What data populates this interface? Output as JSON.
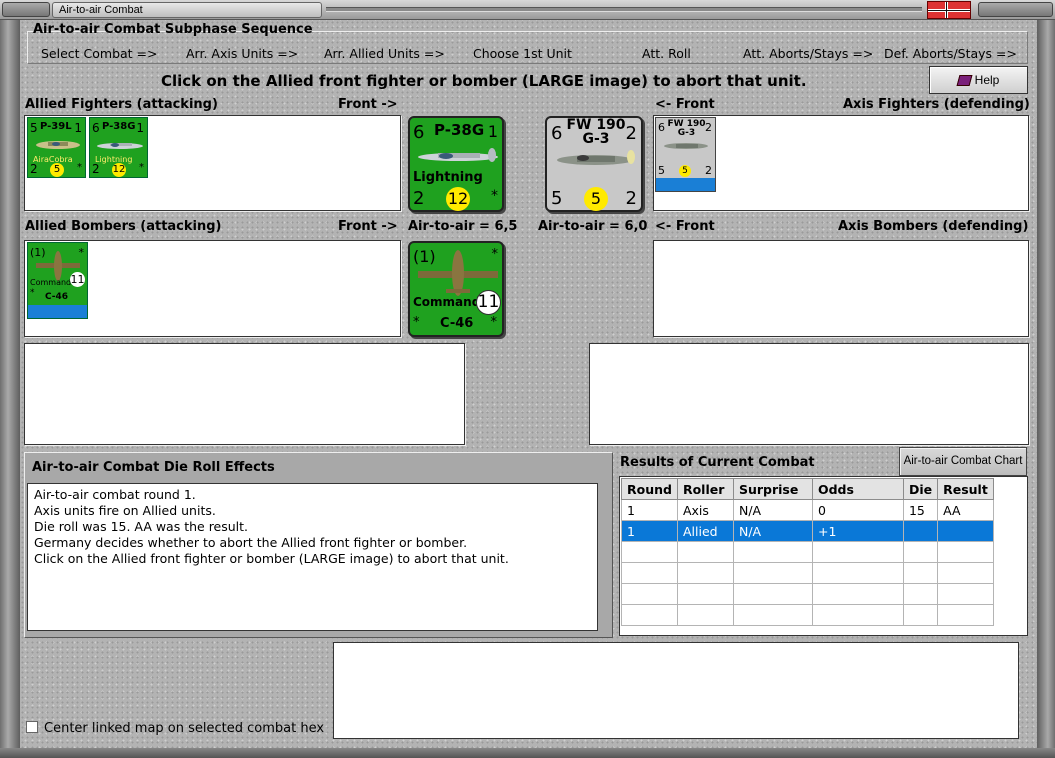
{
  "window": {
    "title": "Air-to-air Combat"
  },
  "sequence": {
    "title": "Air-to-air Combat Subphase Sequence",
    "steps": [
      "Select Combat =>",
      "Arr. Axis Units =>",
      "Arr. Allied Units =>",
      "Choose 1st Unit",
      "Att. Roll",
      "Att. Aborts/Stays =>",
      "Def. Aborts/Stays =>"
    ]
  },
  "instruction": "Click on the Allied front fighter or bomber  (LARGE image) to abort that unit.",
  "help_label": "Help",
  "labels": {
    "allied_fighters": "Allied Fighters (attacking)",
    "front_right": "Front ->",
    "front_left": "<- Front",
    "axis_fighters": "Axis Fighters (defending)",
    "allied_bombers": "Allied Bombers (attacking)",
    "allied_air_to_air": "Air-to-air = 6,5",
    "axis_air_to_air": "Air-to-air = 6,0",
    "axis_bombers": "Axis Bombers (defending)"
  },
  "allied_fighters": [
    {
      "tl": "5",
      "name": "P-39L",
      "tr": "1",
      "sub": "AiraCobra",
      "bl": "2",
      "value": "5",
      "br": "*"
    },
    {
      "tl": "6",
      "name": "P-38G",
      "tr": "1",
      "sub": "Lightning",
      "bl": "2",
      "value": "12",
      "br": "*"
    }
  ],
  "allied_front_fighter": {
    "tl": "6",
    "name": "P-38G",
    "tr": "1",
    "sub": "Lightning",
    "bl": "2",
    "value": "12",
    "br": "*"
  },
  "axis_front_fighter": {
    "tl": "6",
    "name": "FW 190 G-3",
    "tr": "2",
    "bl": "5",
    "value": "5",
    "br": "2"
  },
  "axis_fighters": [
    {
      "tl": "6",
      "name": "FW 190 G-3",
      "tr": "2",
      "bl": "5",
      "value": "5",
      "br": "2"
    }
  ],
  "allied_bombers": [
    {
      "tl": "(1)",
      "tr": "*",
      "sub": "Commando",
      "value": "11",
      "star": "*",
      "name": "C-46"
    }
  ],
  "allied_front_bomber": {
    "tl": "(1)",
    "tr": "*",
    "sub": "Commando",
    "value": "11",
    "star_l": "*",
    "name": "C-46",
    "star_r": "*"
  },
  "effects": {
    "title": "Air-to-air Combat Die Roll Effects",
    "lines": [
      "Air-to-air combat round 1.",
      "Axis units fire on Allied units.",
      "Die roll was 15.  AA was the result.",
      "Germany decides whether to abort the Allied front fighter or bomber.",
      "Click on the Allied front fighter or bomber  (LARGE image) to abort that unit."
    ]
  },
  "results": {
    "title": "Results of Current Combat",
    "chart_button": "Air-to-air Combat Chart",
    "columns": [
      "Round",
      "Roller",
      "Surprise",
      "Odds",
      "Die",
      "Result"
    ],
    "rows": [
      [
        "1",
        "Axis",
        "N/A",
        "0",
        "15",
        "AA"
      ],
      [
        "1",
        "Allied",
        "N/A",
        "+1",
        "",
        ""
      ]
    ],
    "selected_row": 1
  },
  "center_map_label": "Center linked map on selected combat hex",
  "colors": {
    "allied_counter": "#1fa11f",
    "axis_counter": "#c8c8c8",
    "selection": "#0a78d7",
    "value_circle": "#ffea00"
  }
}
